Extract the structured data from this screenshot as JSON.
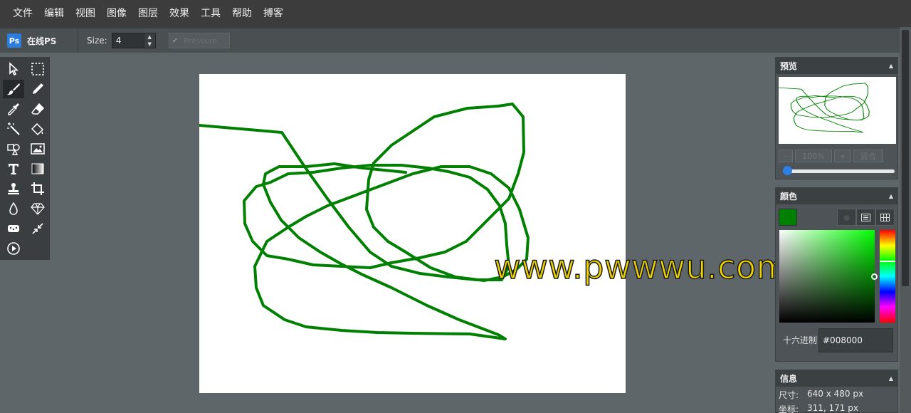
{
  "menu": [
    "文件",
    "编辑",
    "视图",
    "图像",
    "图层",
    "效果",
    "工具",
    "帮助",
    "搏客"
  ],
  "toolbar": {
    "logo_badge": "Ps",
    "logo_text": "在线PS",
    "size_label": "Size:",
    "size_value": "4",
    "pressure_label": "Pressure"
  },
  "tools": [
    {
      "icon": "select-arrow-icon"
    },
    {
      "icon": "marquee-select-icon"
    },
    {
      "icon": "brush-icon",
      "active": true
    },
    {
      "icon": "pencil-icon"
    },
    {
      "icon": "eyedropper-icon"
    },
    {
      "icon": "eraser-icon"
    },
    {
      "icon": "magic-wand-icon"
    },
    {
      "icon": "fill-bucket-icon"
    },
    {
      "icon": "shapes-icon"
    },
    {
      "icon": "image-icon"
    },
    {
      "icon": "text-icon"
    },
    {
      "icon": "gradient-icon"
    },
    {
      "icon": "clone-stamp-icon"
    },
    {
      "icon": "crop-icon"
    },
    {
      "icon": "blur-drop-icon"
    },
    {
      "icon": "sharpen-diamond-icon"
    },
    {
      "icon": "sponge-icon"
    },
    {
      "icon": "resize-arrows-icon"
    },
    {
      "icon": "play-icon"
    }
  ],
  "canvas": {
    "stroke_color": "#008000"
  },
  "watermark": "www.pwwwu.com",
  "preview_panel": {
    "title": "预览",
    "zoom_minus": "-",
    "zoom_value": "100%",
    "zoom_plus": "+",
    "fit_label": "适合"
  },
  "color_panel": {
    "title": "颜色",
    "current_color": "#008000",
    "hex_label": "十六进制",
    "hex_value": "#008000"
  },
  "info_panel": {
    "title": "信息",
    "size_key": "尺寸:",
    "size_value": "640 x 480 px",
    "coord_key": "坐标:",
    "coord_value": "311, 171 px"
  }
}
